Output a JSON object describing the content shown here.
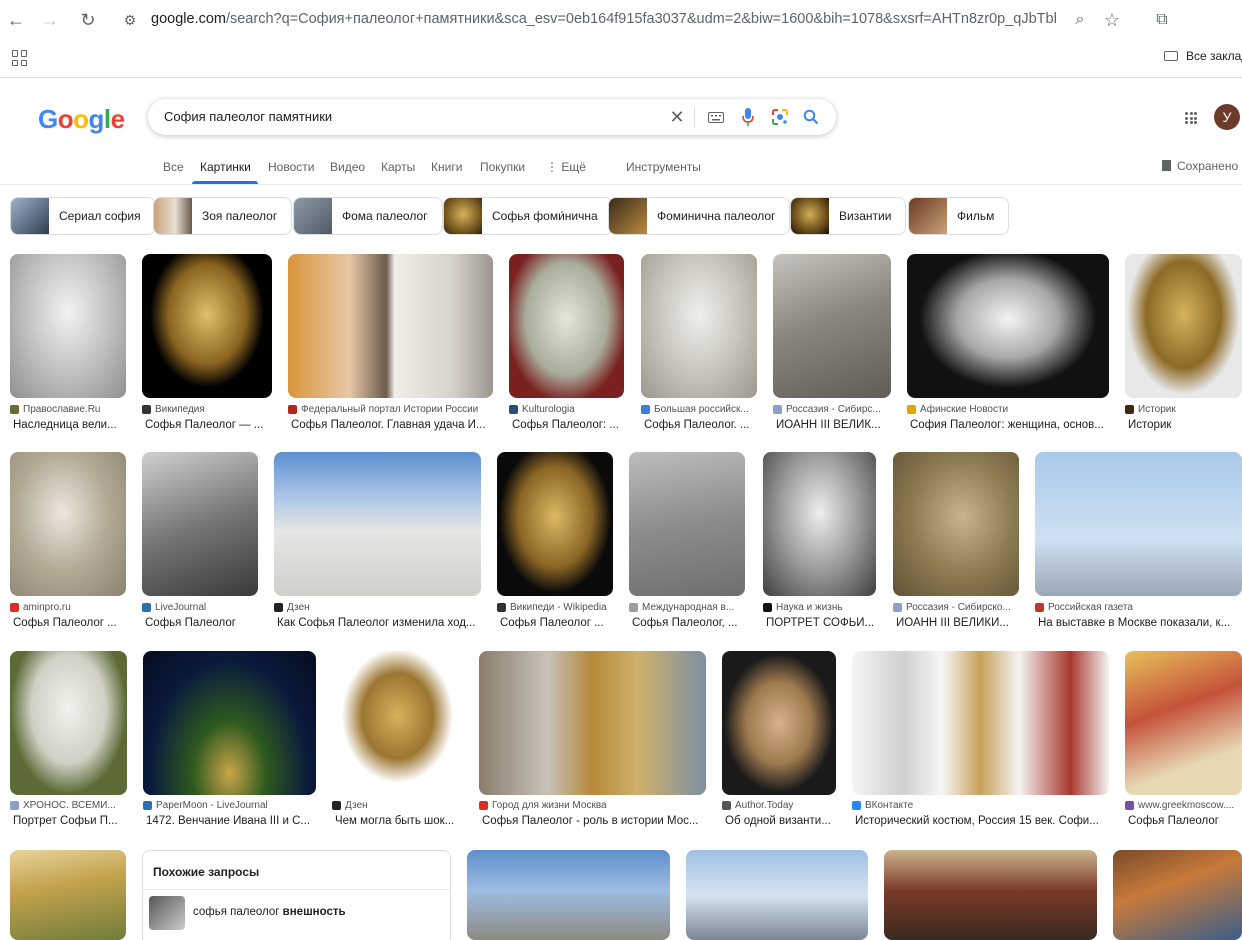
{
  "browser": {
    "url_host": "google.com",
    "url_rest": "/search?q=София+палеолог+памятники&sca_esv=0eb164f915fa3037&udm=2&biw=1600&bih=1078&sxsrf=AHTn8zr0p_qJbTbbW...",
    "bookmarks_folder": "Все заклад"
  },
  "header": {
    "logo": "Google",
    "query": "София палеолог памятники",
    "avatar_letter": "У"
  },
  "tabs": [
    {
      "label": "Все"
    },
    {
      "label": "Картинки"
    },
    {
      "label": "Новости"
    },
    {
      "label": "Видео"
    },
    {
      "label": "Карты"
    },
    {
      "label": "Книги"
    },
    {
      "label": "Покупки"
    },
    {
      "label": "⋮ Ещё"
    },
    {
      "label": "Инструменты"
    }
  ],
  "saved_label": "Сохранено",
  "chips": [
    {
      "label": "Сериал софия"
    },
    {
      "label": "Зоя палеолог"
    },
    {
      "label": "Фома палеолог"
    },
    {
      "label": "Софья фоми́нична"
    },
    {
      "label": "Фоминична палеолог"
    },
    {
      "label": "Византии"
    },
    {
      "label": "Фильм"
    }
  ],
  "results_row1": [
    {
      "source": "Православие.Ru",
      "title": "Наследница вели...",
      "color": "#6b6b2f"
    },
    {
      "source": "Википедия",
      "title": "Софья Палеолог — ...",
      "color": "#333333"
    },
    {
      "source": "Федеральный портал Истории России",
      "title": "Софья Палеолог. Главная удача И...",
      "color": "#b3261e"
    },
    {
      "source": "Kulturologia",
      "title": "Софья Палеолог: ...",
      "color": "#2a4d7a"
    },
    {
      "source": "Большая российск...",
      "title": "Софья Палеолог. ...",
      "color": "#3c7dd9"
    },
    {
      "source": "Россазия - Сибирс...",
      "title": "ИОАНН III ВЕЛИК...",
      "color": "#8aa0c8"
    },
    {
      "source": "Афинские Новости",
      "title": "София Палеолог: женщина, основ...",
      "color": "#e2a400"
    },
    {
      "source": "Историк",
      "title": "Историк",
      "color": "#3a2a10"
    }
  ],
  "results_row2": [
    {
      "source": "aminpro.ru",
      "title": "Софья Палеолог ...",
      "color": "#d93025"
    },
    {
      "source": "LiveJournal",
      "title": "Софья Палеолог",
      "color": "#2a6fb0"
    },
    {
      "source": "Дзен",
      "title": "Как Софья Палеолог изменила ход...",
      "color": "#222222"
    },
    {
      "source": "Википеди - Wikipedia",
      "title": "Софья Палеолог ...",
      "color": "#333333"
    },
    {
      "source": "Международная в...",
      "title": "Софья Палеолог, ...",
      "color": "#9e9e9e"
    },
    {
      "source": "Наука и жизнь",
      "title": "ПОРТРЕТ СОФЬИ...",
      "color": "#111111"
    },
    {
      "source": "Россазия - Сибирско...",
      "title": "ИОАНН III ВЕЛИКИ...",
      "color": "#8aa0c8"
    },
    {
      "source": "Российская газета",
      "title": "На выставке в Москве показали, к...",
      "color": "#c0392b"
    }
  ],
  "results_row3": [
    {
      "source": "ХРОНОС. ВСЕМИ...",
      "title": "Портрет Софьи П...",
      "color": "#8aa0c8"
    },
    {
      "source": "PaperMoon - LiveJournal",
      "title": "1472. Венчание Ивана III и С...",
      "color": "#2a6fb0"
    },
    {
      "source": "Дзен",
      "title": "Чем могла быть шок...",
      "color": "#222222"
    },
    {
      "source": "Город для жизни Москва",
      "title": "Софья Палеолог - роль в истории Мос...",
      "color": "#d93025"
    },
    {
      "source": "Author.Today",
      "title": "Об одной византи...",
      "color": "#555555"
    },
    {
      "source": "ВКонтакте",
      "title": "Исторический костюм, Россия 15 век. Софи...",
      "color": "#2787f5"
    },
    {
      "source": "www.greekmoscow....",
      "title": "Софья Палеолог",
      "color": "#7b4fa0"
    }
  ],
  "related": {
    "title": "Похожие запросы",
    "item_plain": "софья палеолог",
    "item_bold": "внешность"
  }
}
